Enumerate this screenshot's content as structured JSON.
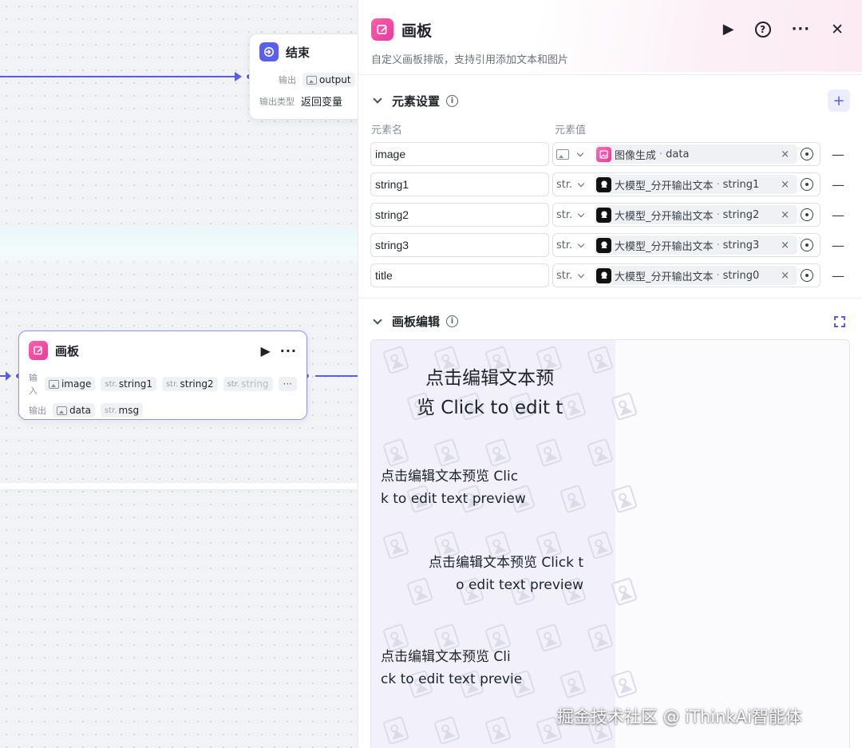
{
  "canvas": {
    "end_node": {
      "title": "结束",
      "output_label": "输出",
      "output_chip": "output",
      "output_type_label": "输出类型",
      "output_type_value": "返回变量"
    },
    "board_node": {
      "title": "画板",
      "input_label": "输入",
      "inputs": [
        {
          "type": "",
          "name": "image"
        },
        {
          "type": "str.",
          "name": "string1"
        },
        {
          "type": "str.",
          "name": "string2"
        },
        {
          "type": "str.",
          "name": "string"
        }
      ],
      "more": "···",
      "output_label": "输出",
      "outputs": [
        {
          "type": "",
          "name": "data"
        },
        {
          "type": "str.",
          "name": "msg"
        }
      ]
    }
  },
  "panel": {
    "title": "画板",
    "description": "自定义画板排版，支持引用添加文本和图片",
    "actions": {
      "run": "▶",
      "help": "?",
      "more": "···",
      "close": "✕"
    },
    "elements_section": {
      "title": "元素设置",
      "add": "+",
      "col_name": "元素名",
      "col_value": "元素值",
      "rows": [
        {
          "name": "image",
          "type": "",
          "source": "图像生成",
          "var": "data",
          "icon": "pink"
        },
        {
          "name": "string1",
          "type": "str.",
          "source": "大模型_分开输出文本",
          "var": "string1",
          "icon": "dark"
        },
        {
          "name": "string2",
          "type": "str.",
          "source": "大模型_分开输出文本",
          "var": "string2",
          "icon": "dark"
        },
        {
          "name": "string3",
          "type": "str.",
          "source": "大模型_分开输出文本",
          "var": "string3",
          "icon": "dark"
        },
        {
          "name": "title",
          "type": "str.",
          "source": "大模型_分开输出文本",
          "var": "string0",
          "icon": "dark"
        }
      ]
    },
    "editor_section": {
      "title": "画板编辑",
      "texts": [
        {
          "line1": "点击编辑文本预",
          "line2": "览 Click to edit t"
        },
        {
          "line1": "点击编辑文本预览 Clic",
          "line2": "k to edit text preview"
        },
        {
          "line1": "点击编辑文本预览 Click t",
          "line2": "o edit text preview"
        },
        {
          "line1": "点击编辑文本预览 Cli",
          "line2": "ck to edit text previe"
        }
      ]
    }
  },
  "watermark": "掘金技术社区 @ iThinkAi智能体",
  "colors": {
    "accent": "#5a5ce8",
    "brand_pink": "#e83aa0"
  }
}
